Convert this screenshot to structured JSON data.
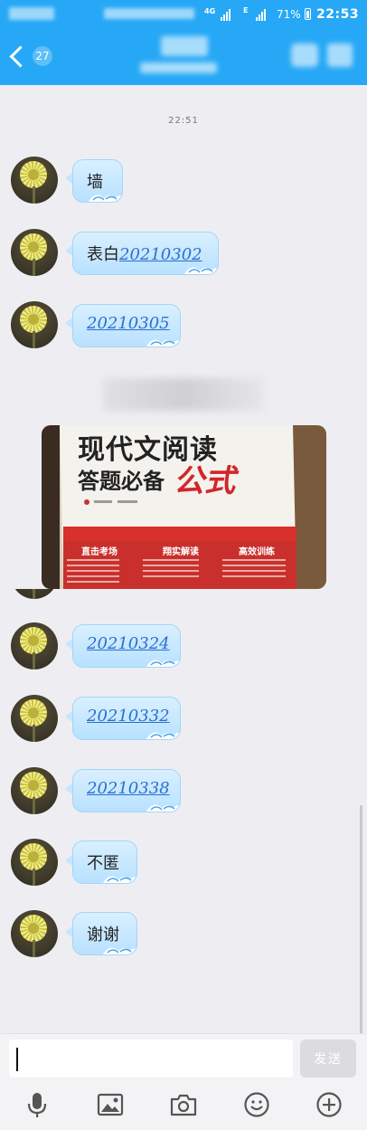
{
  "status_bar": {
    "network": "4G",
    "data_icon": "E",
    "battery": "71%",
    "time": "22:53"
  },
  "header": {
    "back_count": "27",
    "back_icon": "chevron-left-icon"
  },
  "chat": {
    "time_separator": "22:51",
    "messages": [
      {
        "text": "墙",
        "is_link": false
      },
      {
        "prefix": "表白",
        "text": "20210302",
        "is_link": true
      },
      {
        "text": "20210305",
        "is_link": true
      },
      {
        "type": "image",
        "book_title": "现代文阅读",
        "book_subtitle": "答题必备",
        "book_subtitle_red": "公式",
        "sections": [
          "直击考场",
          "翔实解读",
          "高效训练"
        ]
      },
      {
        "text": "20210324",
        "is_link": true
      },
      {
        "text": "20210332",
        "is_link": true
      },
      {
        "text": "20210338",
        "is_link": true
      },
      {
        "text": "不匿",
        "is_link": false
      },
      {
        "text": "谢谢",
        "is_link": false
      }
    ]
  },
  "input": {
    "value": "",
    "send_label": "发送"
  },
  "toolbar": {
    "icons": [
      "microphone-icon",
      "image-icon",
      "camera-icon",
      "emoji-icon",
      "plus-icon"
    ]
  },
  "colors": {
    "header_blue": "#27a8f6",
    "bubble": "#c6e6ff",
    "link": "#2a6fd0"
  }
}
